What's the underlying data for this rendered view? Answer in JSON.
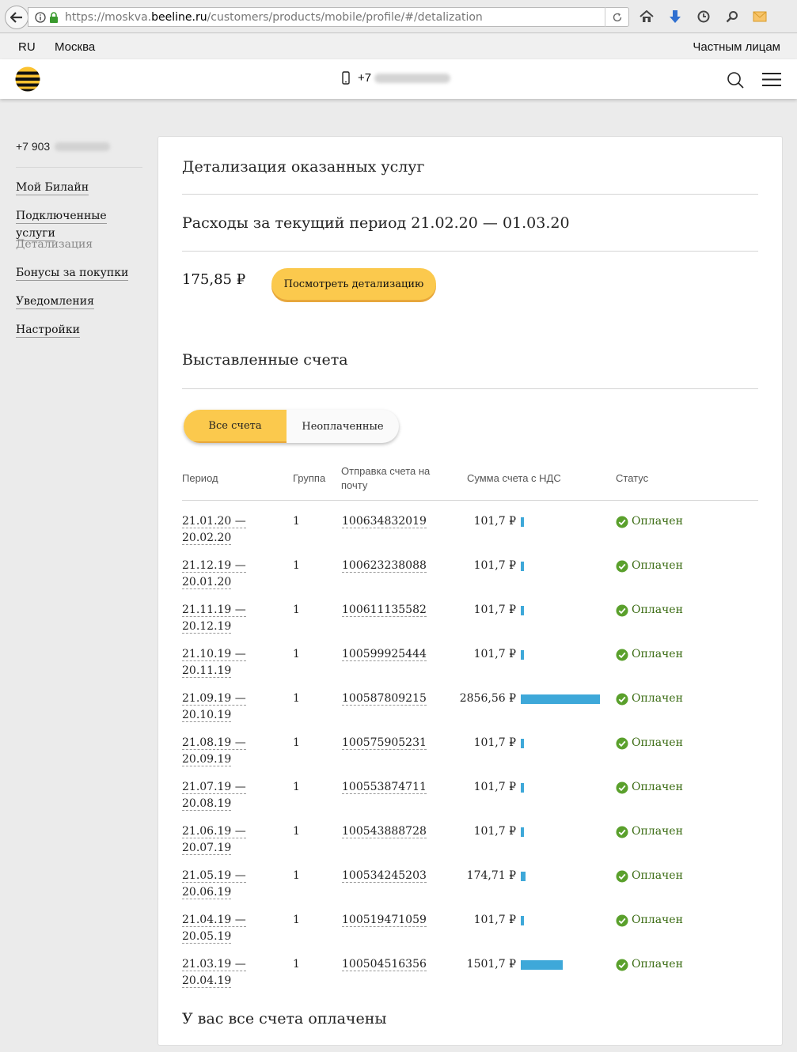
{
  "browser": {
    "url_prefix": "https://moskva.",
    "url_domain": "beeline.ru",
    "url_path": "/customers/products/mobile/profile/#/detalization"
  },
  "topline": {
    "lang": "RU",
    "city": "Москва",
    "segment": "Частным лицам"
  },
  "header": {
    "phone_prefix": "+7"
  },
  "sidebar": {
    "phone": "+7 903",
    "items": [
      {
        "label": "Мой Билайн",
        "active": false
      },
      {
        "label": "Подключенные услуги",
        "active": false
      },
      {
        "label": "Детализация",
        "active": true
      },
      {
        "label": "Бонусы за покупки",
        "active": false
      },
      {
        "label": "Уведомления",
        "active": false
      },
      {
        "label": "Настройки",
        "active": false
      }
    ]
  },
  "main": {
    "title": "Детализация оказанных услуг",
    "period_title": "Расходы за текущий период 21.02.20 — 01.03.20",
    "amount": "175,85 ₽",
    "view_button": "Посмотреть детализацию",
    "invoices_title": "Выставленные счета",
    "tabs": [
      "Все счета",
      "Неоплаченные"
    ],
    "columns": [
      "Период",
      "Группа",
      "Отправка счета на почту",
      "Сумма счета с НДС",
      "Статус"
    ],
    "rows": [
      {
        "period_from": "21.01.20 —",
        "period_to": "20.02.20",
        "group": "1",
        "invoice": "100634832019",
        "sum": "101,7 ₽",
        "sum_value": 101.7,
        "status": "Оплачен"
      },
      {
        "period_from": "21.12.19 —",
        "period_to": "20.01.20",
        "group": "1",
        "invoice": "100623238088",
        "sum": "101,7 ₽",
        "sum_value": 101.7,
        "status": "Оплачен"
      },
      {
        "period_from": "21.11.19 —",
        "period_to": "20.12.19",
        "group": "1",
        "invoice": "100611135582",
        "sum": "101,7 ₽",
        "sum_value": 101.7,
        "status": "Оплачен"
      },
      {
        "period_from": "21.10.19 —",
        "period_to": "20.11.19",
        "group": "1",
        "invoice": "100599925444",
        "sum": "101,7 ₽",
        "sum_value": 101.7,
        "status": "Оплачен"
      },
      {
        "period_from": "21.09.19 —",
        "period_to": "20.10.19",
        "group": "1",
        "invoice": "100587809215",
        "sum": "2856,56 ₽",
        "sum_value": 2856.56,
        "status": "Оплачен"
      },
      {
        "period_from": "21.08.19 —",
        "period_to": "20.09.19",
        "group": "1",
        "invoice": "100575905231",
        "sum": "101,7 ₽",
        "sum_value": 101.7,
        "status": "Оплачен"
      },
      {
        "period_from": "21.07.19 —",
        "period_to": "20.08.19",
        "group": "1",
        "invoice": "100553874711",
        "sum": "101,7 ₽",
        "sum_value": 101.7,
        "status": "Оплачен"
      },
      {
        "period_from": "21.06.19 —",
        "period_to": "20.07.19",
        "group": "1",
        "invoice": "100543888728",
        "sum": "101,7 ₽",
        "sum_value": 101.7,
        "status": "Оплачен"
      },
      {
        "period_from": "21.05.19 —",
        "period_to": "20.06.19",
        "group": "1",
        "invoice": "100534245203",
        "sum": "174,71 ₽",
        "sum_value": 174.71,
        "status": "Оплачен"
      },
      {
        "period_from": "21.04.19 —",
        "period_to": "20.05.19",
        "group": "1",
        "invoice": "100519471059",
        "sum": "101,7 ₽",
        "sum_value": 101.7,
        "status": "Оплачен"
      },
      {
        "period_from": "21.03.19 —",
        "period_to": "20.04.19",
        "group": "1",
        "invoice": "100504516356",
        "sum": "1501,7 ₽",
        "sum_value": 1501.7,
        "status": "Оплачен"
      }
    ],
    "footer_note": "У вас все счета оплачены"
  },
  "colors": {
    "accent_yellow": "#fbc94d",
    "bar_blue": "#3ea8d9",
    "paid_green": "#5aa02c"
  }
}
